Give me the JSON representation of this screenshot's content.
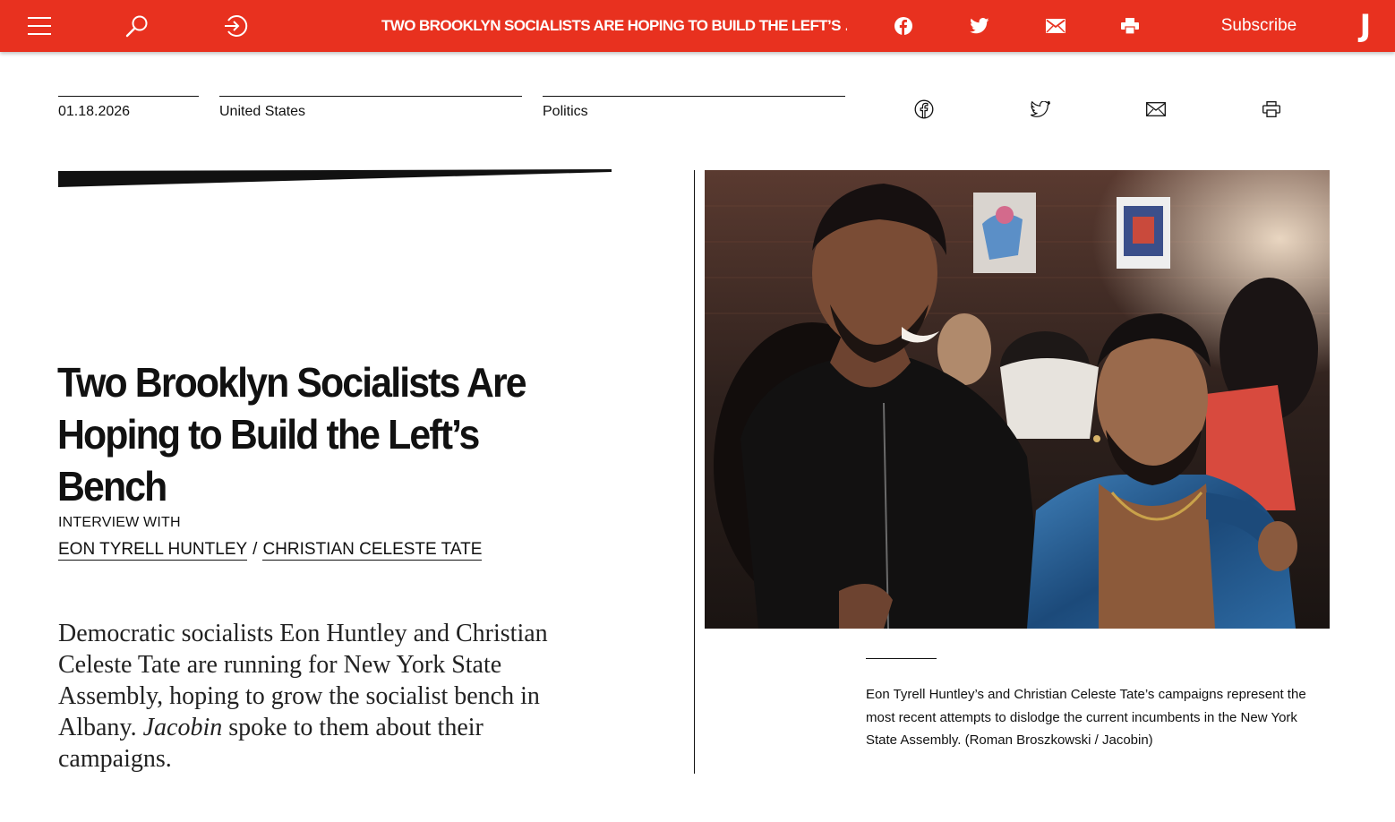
{
  "topbar": {
    "title": "TWO BROOKLYN SOCIALISTS ARE HOPING TO BUILD THE LEFT’S …",
    "subscribe_label": "Subscribe",
    "logo": "J",
    "icons": [
      "menu-icon",
      "search-icon",
      "login-icon",
      "facebook-icon",
      "twitter-icon",
      "mail-icon",
      "print-icon"
    ]
  },
  "meta": {
    "date": "01.18.2026",
    "location": "United States",
    "topic": "Politics",
    "share_icons": [
      "facebook-icon",
      "twitter-icon",
      "mail-icon",
      "print-icon"
    ]
  },
  "article": {
    "headline": "Two Brooklyn Socialists Are Hoping to Build the Left’s Bench",
    "interview_label": "INTERVIEW WITH",
    "authors": [
      "EON TYRELL HUNTLEY",
      "CHRISTIAN CELESTE TATE"
    ],
    "author_separator": "/",
    "dek_part1": "Democratic socialists Eon Huntley and Christian Celeste Tate are running for New York State Assembly, hoping to grow the socialist bench in Albany. ",
    "dek_italic": "Jacobin",
    "dek_part2": " spoke to them about their campaigns."
  },
  "image": {
    "caption": "Eon Tyrell Huntley’s and Christian Celeste Tate’s campaigns represent the most recent attempts to dislodge the current incumbents in the New York State Assembly. (Roman Broszkowski / Jacobin)"
  },
  "colors": {
    "brand_red": "#e8311f",
    "text": "#111111",
    "background": "#ffffff"
  }
}
